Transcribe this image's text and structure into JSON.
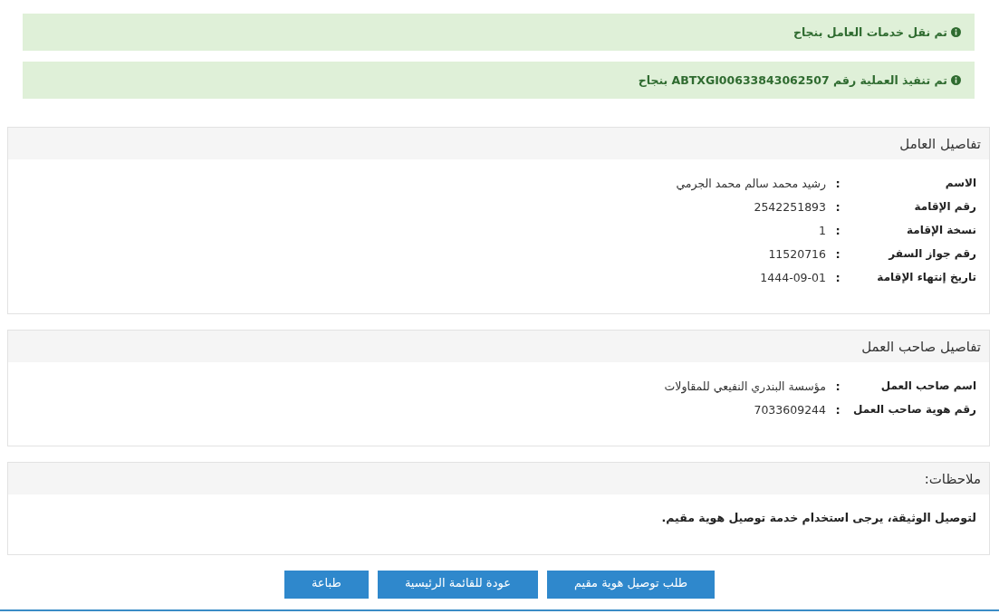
{
  "alerts": [
    {
      "text": "تم نقل خدمات العامل بنجاح"
    },
    {
      "text": "تم تنفيذ العملية رقم ABTXGI00633843062507 بنجاح"
    }
  ],
  "panels": [
    {
      "kind": "fields",
      "title": "تفاصيل العامل",
      "fields": [
        {
          "label": "الاسم",
          "separator": ":",
          "value": "رشيد محمد سالم محمد الجرمي"
        },
        {
          "label": "رقم الإقامة",
          "separator": ":",
          "value": "2542251893"
        },
        {
          "label": "نسخة الإقامة",
          "separator": ":",
          "value": "1"
        },
        {
          "label": "رقم جواز السفر",
          "separator": ":",
          "value": "11520716"
        },
        {
          "label": "تاريخ إنتهاء الإقامة",
          "separator": ":",
          "value": "1444-09-01"
        }
      ]
    },
    {
      "kind": "fields",
      "title": "تفاصيل صاحب العمل",
      "fields": [
        {
          "label": "اسم صاحب العمل",
          "separator": ":",
          "value": "مؤسسة البندري النفيعي للمقاولات"
        },
        {
          "label": "رقم هوية صاحب العمل",
          "separator": ":",
          "value": "7033609244"
        }
      ]
    },
    {
      "kind": "note",
      "title": "ملاحظات:",
      "text": "لتوصيل الوثيقة، يرجى استخدام خدمة توصيل هوية مقيم."
    }
  ],
  "buttons": [
    "طلب توصيل هوية مقيم",
    "عودة للقائمة الرئيسية",
    "طباعة"
  ]
}
